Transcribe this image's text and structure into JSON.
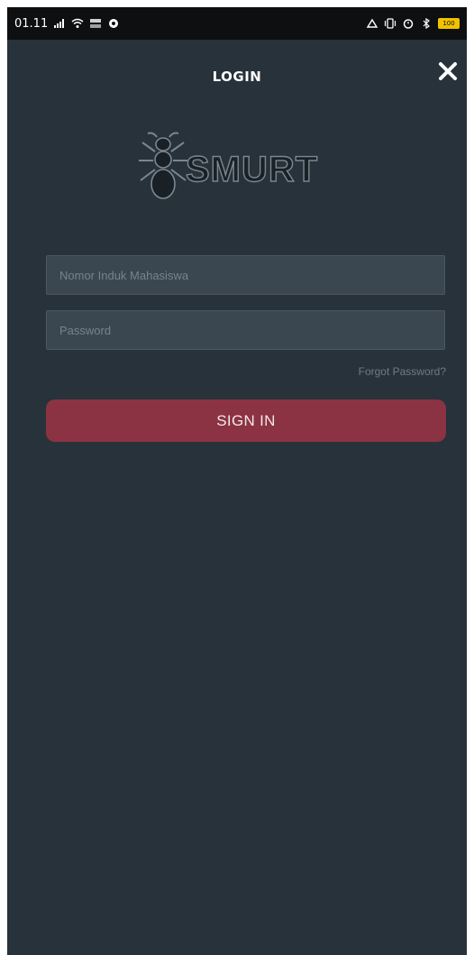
{
  "status_bar": {
    "time": "01.11",
    "battery": "100",
    "icons_left": [
      "signal-icon",
      "wifi-icon",
      "data-speed-icon",
      "notification-icon"
    ],
    "icons_right": [
      "data-saver-icon",
      "vibrate-icon",
      "alarm-icon",
      "bluetooth-icon",
      "battery-icon"
    ]
  },
  "header": {
    "title": "LOGIN",
    "close_icon": "close-icon"
  },
  "logo": {
    "text": "SMURT",
    "icon": "ant-logo-icon"
  },
  "form": {
    "nim_placeholder": "Nomor Induk Mahasiswa",
    "password_placeholder": "Password",
    "forgot_label": "Forgot Password?",
    "signin_label": "SIGN IN"
  },
  "colors": {
    "background": "#27323a",
    "input_background": "#3b4750",
    "signin_button": "#8c3343",
    "status_bar": "#0d0f10"
  }
}
